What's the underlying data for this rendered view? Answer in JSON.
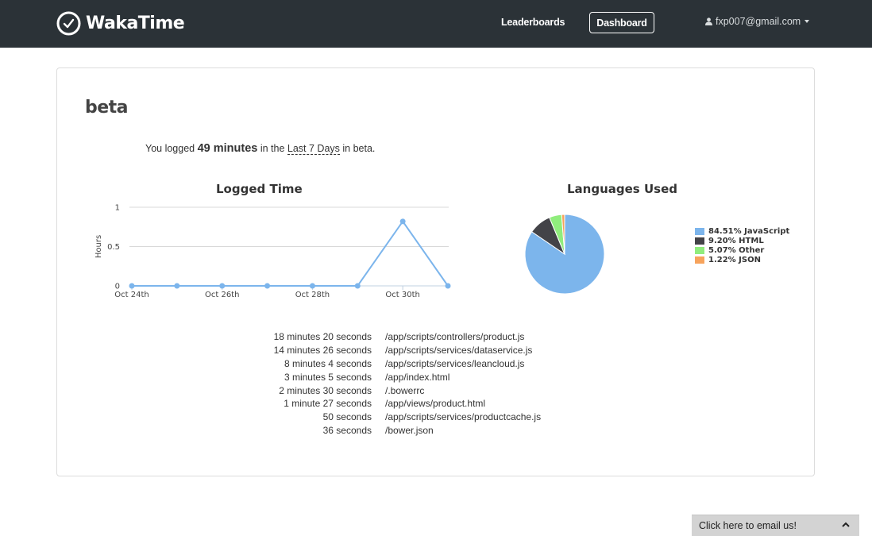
{
  "app": {
    "name": "WakaTime"
  },
  "nav": {
    "leaderboards": "Leaderboards",
    "dashboard": "Dashboard",
    "user_email": "fxp007@gmail.com"
  },
  "project": {
    "name": "beta",
    "summary_prefix": "You logged",
    "summary_minutes": "49 minutes",
    "summary_mid": "in the",
    "summary_range": "Last 7 Days",
    "summary_suffix": "in beta."
  },
  "chart_data": [
    {
      "type": "line",
      "title": "Logged Time",
      "ylabel": "Hours",
      "xlabel": "",
      "x": [
        "Oct 24th",
        "Oct 25th",
        "Oct 26th",
        "Oct 27th",
        "Oct 28th",
        "Oct 29th",
        "Oct 30th",
        "Oct 31st"
      ],
      "x_tick_labels": [
        "Oct 24th",
        "Oct 26th",
        "Oct 28th",
        "Oct 30th"
      ],
      "y_ticks": [
        "0",
        "0.5",
        "1"
      ],
      "ylim": [
        0,
        1
      ],
      "grid": true,
      "color": "#7cb5ec",
      "series": [
        {
          "values": [
            0,
            0,
            0,
            0,
            0,
            0,
            0.82,
            0
          ]
        }
      ]
    },
    {
      "type": "pie",
      "title": "Languages Used",
      "legend_position": "right",
      "slices": [
        {
          "label": "JavaScript",
          "value": 84.51,
          "legend": "84.51% JavaScript",
          "color": "#7cb5ec"
        },
        {
          "label": "HTML",
          "value": 9.2,
          "legend": "9.20% HTML",
          "color": "#434348"
        },
        {
          "label": "Other",
          "value": 5.07,
          "legend": "5.07% Other",
          "color": "#90ed7d"
        },
        {
          "label": "JSON",
          "value": 1.22,
          "legend": "1.22% JSON",
          "color": "#f7a35c"
        }
      ]
    }
  ],
  "files": [
    {
      "duration": "18 minutes 20 seconds",
      "path": "/app/scripts/controllers/product.js"
    },
    {
      "duration": "14 minutes 26 seconds",
      "path": "/app/scripts/services/dataservice.js"
    },
    {
      "duration": "8 minutes 4 seconds",
      "path": "/app/scripts/services/leancloud.js"
    },
    {
      "duration": "3 minutes 5 seconds",
      "path": "/app/index.html"
    },
    {
      "duration": "2 minutes 30 seconds",
      "path": "/.bowerrc"
    },
    {
      "duration": "1 minute 27 seconds",
      "path": "/app/views/product.html"
    },
    {
      "duration": "50 seconds",
      "path": "/app/scripts/services/productcache.js"
    },
    {
      "duration": "36 seconds",
      "path": "/bower.json"
    }
  ],
  "email_widget": {
    "label": "Click here to email us!"
  }
}
